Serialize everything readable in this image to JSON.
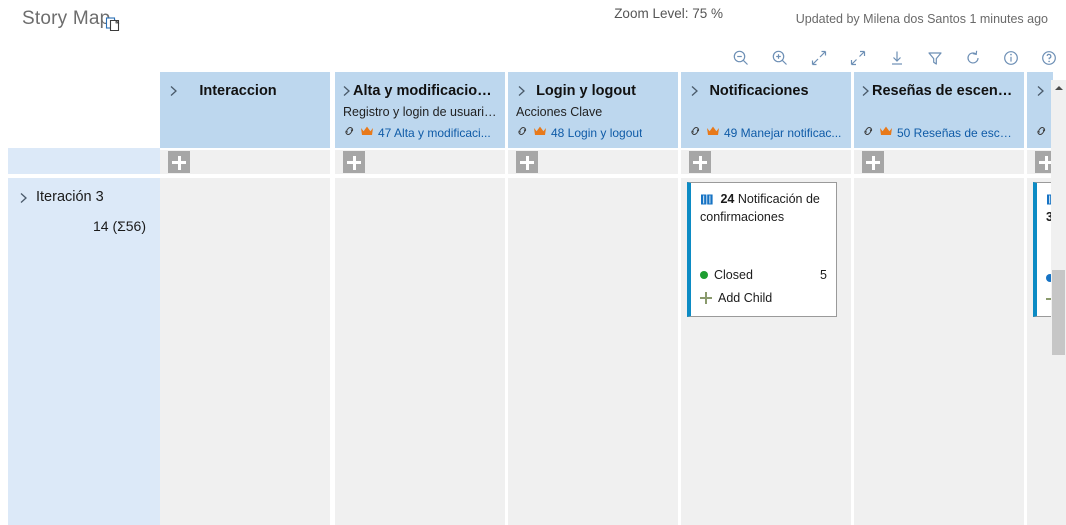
{
  "titlebar": {
    "title": "Story Map",
    "copy_icon": "copy-pages-icon",
    "updated_text": "Updated by Milena dos Santos 1 minutes ago"
  },
  "toolbar": {
    "zoom_label": "Zoom Level: 75 %",
    "buttons": [
      {
        "name": "zoom-out-icon",
        "label": "Zoom Out"
      },
      {
        "name": "zoom-in-icon",
        "label": "Zoom In"
      },
      {
        "name": "collapse-all-icon",
        "label": "Collapse"
      },
      {
        "name": "expand-all-icon",
        "label": "Expand"
      },
      {
        "name": "download-icon",
        "label": "Download"
      },
      {
        "name": "filter-icon",
        "label": "Filter"
      },
      {
        "name": "refresh-icon",
        "label": "Refresh"
      },
      {
        "name": "info-icon",
        "label": "Info"
      },
      {
        "name": "help-icon",
        "label": "Help"
      }
    ]
  },
  "sidebar": {
    "iteration": {
      "name": "Iteración 3",
      "count": "14 (Σ56)",
      "chevron": "chevron-right-icon"
    }
  },
  "columns": [
    {
      "title": "Interaccion",
      "title_centered": true,
      "subtitle": "",
      "link_text": "",
      "link_id": "",
      "add_button": "add-card-button"
    },
    {
      "title": "Alta y modificacion ...",
      "title_centered": false,
      "subtitle": "Registro y login de usuario...",
      "link_text": "47 Alta y modificaci...",
      "link_id": "47",
      "add_button": "add-card-button"
    },
    {
      "title": "Login y logout",
      "title_centered": true,
      "subtitle": "Acciones Clave",
      "link_text": "48 Login y logout",
      "link_id": "48",
      "add_button": "add-card-button"
    },
    {
      "title": "Notificaciones",
      "title_centered": true,
      "subtitle": "",
      "link_text": "49 Manejar notificac...",
      "link_id": "49",
      "add_button": "add-card-button"
    },
    {
      "title": "Reseñas de escenari...",
      "title_centered": false,
      "subtitle": "",
      "link_text": "50 Reseñas de escen...",
      "link_id": "50",
      "add_button": "add-card-button"
    },
    {
      "title": "",
      "title_centered": true,
      "subtitle": "",
      "link_text": "",
      "link_id": "",
      "add_button": "add-card-button"
    }
  ],
  "cards": {
    "notificaciones": {
      "icon": "book-icon",
      "id": "24",
      "title": "Notificación de confirmaciones",
      "status_label": "Closed",
      "status_color": "#1d9e31",
      "status_count": "5",
      "add_child_label": "Add Child"
    },
    "partial": {
      "icon": "book-icon",
      "id": "3",
      "status_color": "#1673c4"
    }
  },
  "scrollbar": {
    "up_arrow": "scroll-up-arrow-icon"
  },
  "colors": {
    "header_blue": "#bdd7ee",
    "sidebar_blue": "#dce9f8",
    "column_gray": "#f0f0f0",
    "link_blue": "#0f5ba7",
    "crown_orange": "#e8791a",
    "card_accent": "#0c8bc4"
  }
}
